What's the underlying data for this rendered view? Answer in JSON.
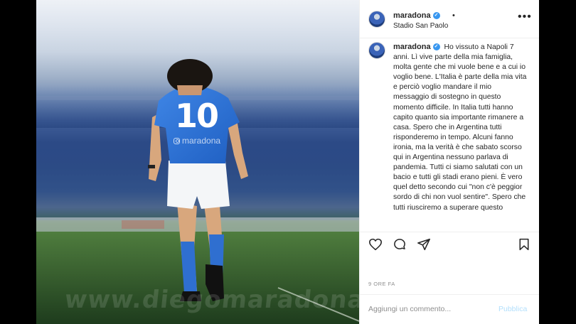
{
  "post": {
    "image_watermark": "www.diegomaradona.com",
    "jersey_number": "10",
    "jersey_tag": "maradona"
  },
  "header": {
    "username": "maradona",
    "verified": "✓",
    "separator": "•",
    "location": "Stadio San Paolo",
    "more_label": "•••"
  },
  "caption": {
    "username": "maradona",
    "verified": "✓",
    "text": "Ho vissuto a Napoli 7 anni. Lì vive parte della mia famiglia, molta gente che mi vuole bene e a cui io voglio bene. L'Italia è parte della mia vita e perciò voglio mandare il mio messaggio di sostegno in questo momento difficile. In Italia tutti hanno capito quanto sia importante rimanere a casa. Spero che in Argentina tutti risponderemo in tempo. Alcuni fanno ironia, ma la verità è che sabato scorso qui in Argentina nessuno parlava di pandemia. Tutti ci siamo salutati con un bacio e tutti gli stadi erano pieni. È vero quel detto secondo cui \"non c'è peggior sordo di chi non vuol sentire\". Spero che tutti riusciremo a superare questo"
  },
  "actions": {
    "icons": [
      "heart-icon",
      "comment-icon",
      "share-icon",
      "bookmark-icon"
    ]
  },
  "timestamp": "9 ORE FA",
  "comment_box": {
    "placeholder": "Aggiungi un commento...",
    "publish_label": "Pubblica"
  },
  "colors": {
    "accent": "#3897f0",
    "publish_disabled": "#b2dffc",
    "secondary_text": "#8e8e8e",
    "napoli_blue": "#2f6fd0"
  }
}
